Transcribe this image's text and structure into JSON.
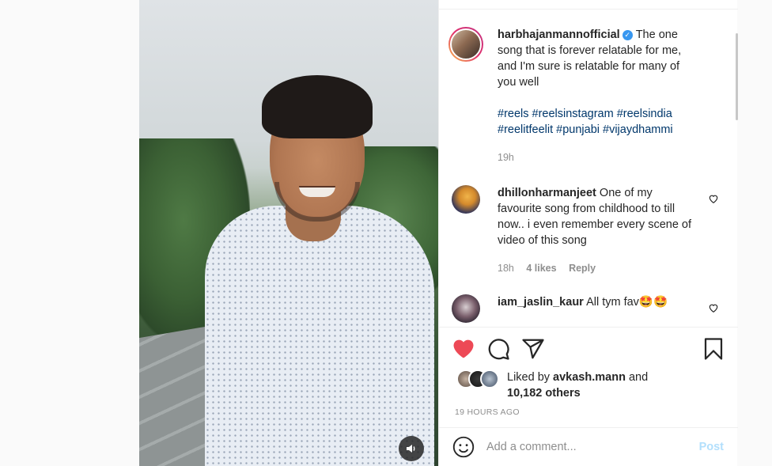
{
  "post": {
    "author": {
      "username": "harbhajanmannofficial",
      "verified_icon": "verified-badge-icon"
    },
    "caption": "The one song that is forever relatable for me, and I'm sure is relatable for many of you well",
    "hashtags": "#reels #reelsinstagram #reelsindia #reelitfeelit #punjabi #vijaydhammi",
    "time_ago": "19h"
  },
  "comments": [
    {
      "username": "dhillonharmanjeet",
      "text": "One of my favourite song from childhood to till now.. i even remember every scene of video of this song",
      "time": "18h",
      "likes": "4 likes",
      "reply_label": "Reply"
    },
    {
      "username": "iam_jaslin_kaur",
      "text": "All tym fav🤩🤩"
    }
  ],
  "actions": {
    "like_icon": "heart-filled-icon",
    "comment_icon": "comment-bubble-icon",
    "share_icon": "paper-plane-icon",
    "save_icon": "bookmark-icon"
  },
  "likes": {
    "prefix": "Liked by",
    "user": "avkash.mann",
    "joiner": "and",
    "others": "10,182 others"
  },
  "timestamp": "19 HOURS AGO",
  "add_comment": {
    "placeholder": "Add a comment...",
    "post_label": "Post"
  },
  "colors": {
    "like_red": "#ed4956",
    "hashtag_blue": "#00376b",
    "post_disabled": "#b2dffc",
    "verified_blue": "#3897f0"
  }
}
